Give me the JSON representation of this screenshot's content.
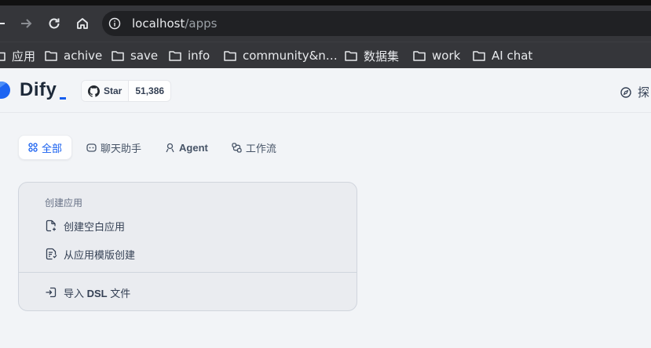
{
  "browser": {
    "url_host": "localhost",
    "url_path": "/apps",
    "bookmarks": [
      {
        "label": "应用",
        "icon": "folder-icon"
      },
      {
        "label": "achive",
        "icon": "folder-icon"
      },
      {
        "label": "save",
        "icon": "folder-icon"
      },
      {
        "label": "info",
        "icon": "folder-icon"
      },
      {
        "label": "community&n…",
        "icon": "folder-icon"
      },
      {
        "label": "数据集",
        "icon": "folder-icon"
      },
      {
        "label": "work",
        "icon": "folder-icon"
      },
      {
        "label": "AI chat",
        "icon": "folder-icon"
      }
    ]
  },
  "header": {
    "logo_text": "Dify",
    "star_label": "Star",
    "star_count": "51,386",
    "explore_label": "探"
  },
  "tabs": [
    {
      "label": "全部",
      "icon": "grid-icon",
      "active": true
    },
    {
      "label": "聊天助手",
      "icon": "chat-bot-icon",
      "active": false
    },
    {
      "label": "Agent",
      "icon": "agent-icon",
      "active": false
    },
    {
      "label": "工作流",
      "icon": "workflow-icon",
      "active": false
    }
  ],
  "create_card": {
    "title": "创建应用",
    "items": [
      {
        "label": "创建空白应用",
        "icon": "file-plus-icon"
      },
      {
        "label": "从应用模版创建",
        "icon": "template-icon"
      }
    ],
    "import": {
      "prefix": "导入 ",
      "bold": "DSL",
      "suffix": " 文件",
      "icon": "import-icon"
    }
  },
  "colors": {
    "accent": "#155eef",
    "chrome_bg": "#35363a",
    "page_bg": "#f2f4f7"
  }
}
